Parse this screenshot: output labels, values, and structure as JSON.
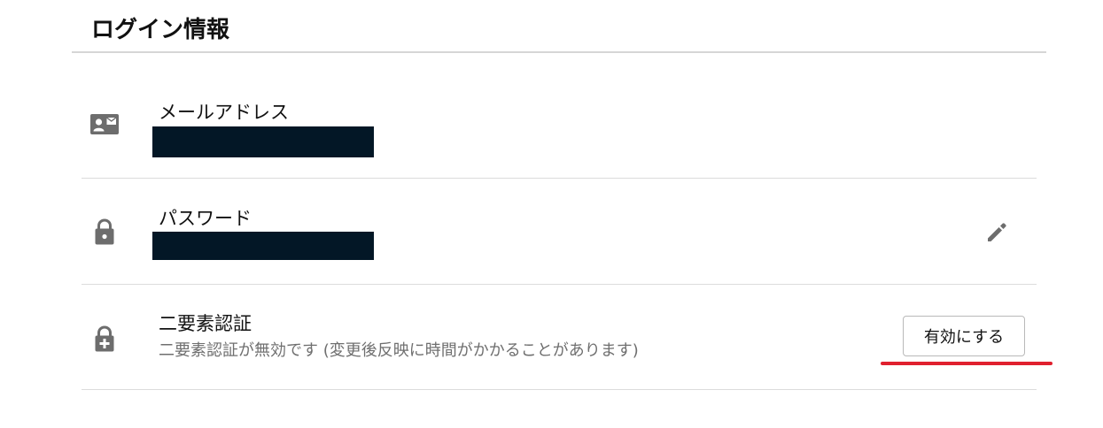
{
  "section": {
    "title": "ログイン情報"
  },
  "rows": {
    "email": {
      "label": "メールアドレス",
      "icon": "contact-card-icon",
      "value_redacted": true
    },
    "password": {
      "label": "パスワード",
      "icon": "lock-icon",
      "value_redacted": true,
      "edit_icon": "pencil-icon"
    },
    "two_factor": {
      "label": "二要素認証",
      "icon": "lock-plus-icon",
      "status": "二要素認証が無効です (変更後反映に時間がかかることがあります)",
      "enable_button_label": "有効にする"
    }
  },
  "colors": {
    "icon_gray": "#6d6d6d",
    "redaction": "#031726",
    "highlight_underline": "#e0202e",
    "divider": "#dcdcdc"
  }
}
